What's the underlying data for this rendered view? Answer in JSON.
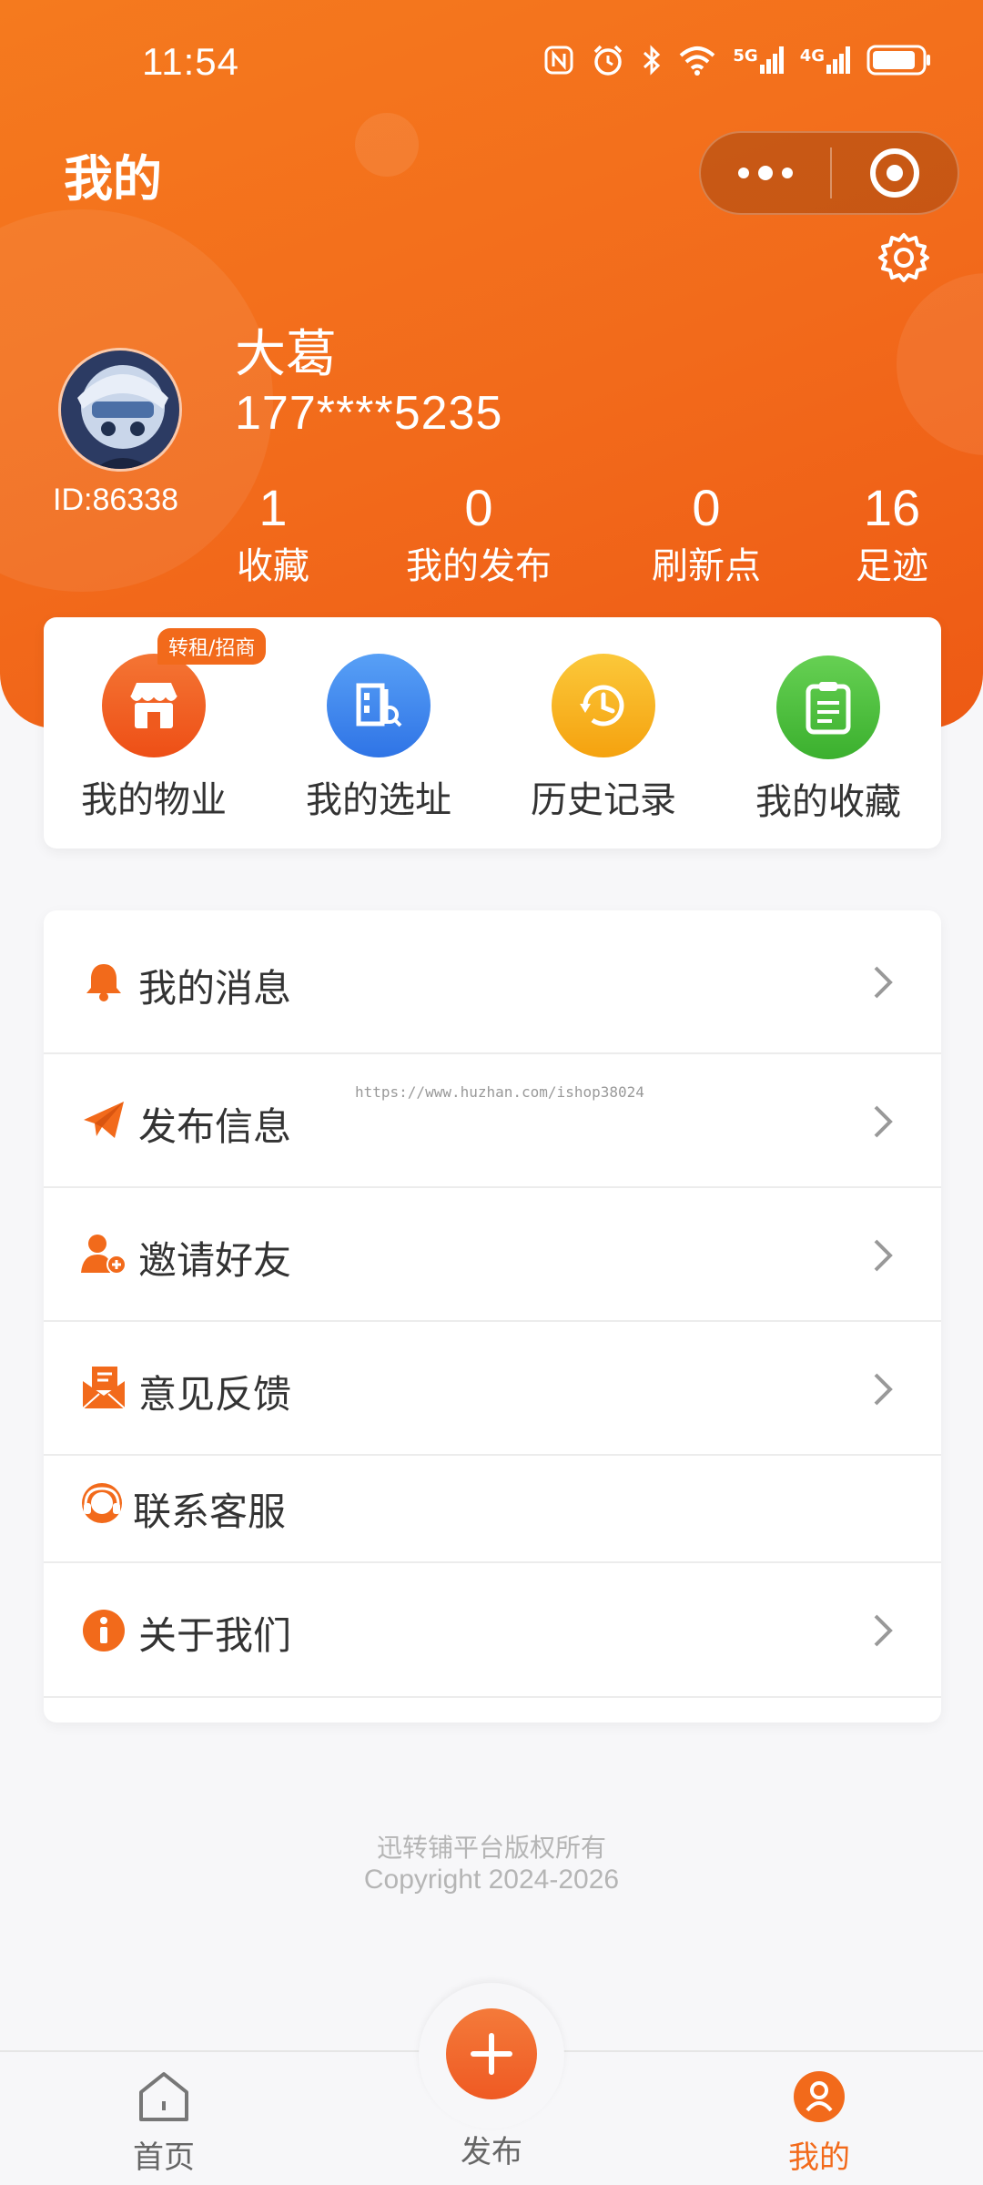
{
  "status_bar": {
    "time": "11:54",
    "signal_5g": "5G",
    "signal_4g": "4G"
  },
  "header": {
    "title": "我的"
  },
  "user": {
    "name": "大葛",
    "phone": "177****5235",
    "id_text": "ID:86338"
  },
  "stats": [
    {
      "value": "1",
      "label": "收藏"
    },
    {
      "value": "0",
      "label": "我的发布"
    },
    {
      "value": "0",
      "label": "刷新点"
    },
    {
      "value": "16",
      "label": "足迹"
    }
  ],
  "quick_actions": {
    "badge": "转租/招商",
    "items": [
      {
        "label": "我的物业",
        "icon": "store-icon",
        "color": "#f05a1a"
      },
      {
        "label": "我的选址",
        "icon": "address-search-icon",
        "color": "#3d86f0"
      },
      {
        "label": "历史记录",
        "icon": "history-icon",
        "color": "#f7b21c"
      },
      {
        "label": "我的收藏",
        "icon": "clipboard-icon",
        "color": "#4cc23d"
      }
    ]
  },
  "menu": {
    "items": [
      {
        "label": "我的消息",
        "icon": "bell-icon"
      },
      {
        "label": "发布信息",
        "icon": "paper-plane-icon"
      },
      {
        "label": "邀请好友",
        "icon": "add-user-icon"
      },
      {
        "label": "意见反馈",
        "icon": "feedback-envelope-icon"
      },
      {
        "label": "联系客服",
        "icon": "headset-icon"
      },
      {
        "label": "关于我们",
        "icon": "info-icon"
      }
    ]
  },
  "watermark": "https://www.huzhan.com/ishop38024",
  "footer": {
    "line1": "迅转铺平台版权所有",
    "line2": "Copyright 2024-2026"
  },
  "tabbar": {
    "home": "首页",
    "publish": "发布",
    "mine": "我的"
  },
  "colors": {
    "accent": "#f26a1b",
    "background": "#f7f7f9"
  }
}
